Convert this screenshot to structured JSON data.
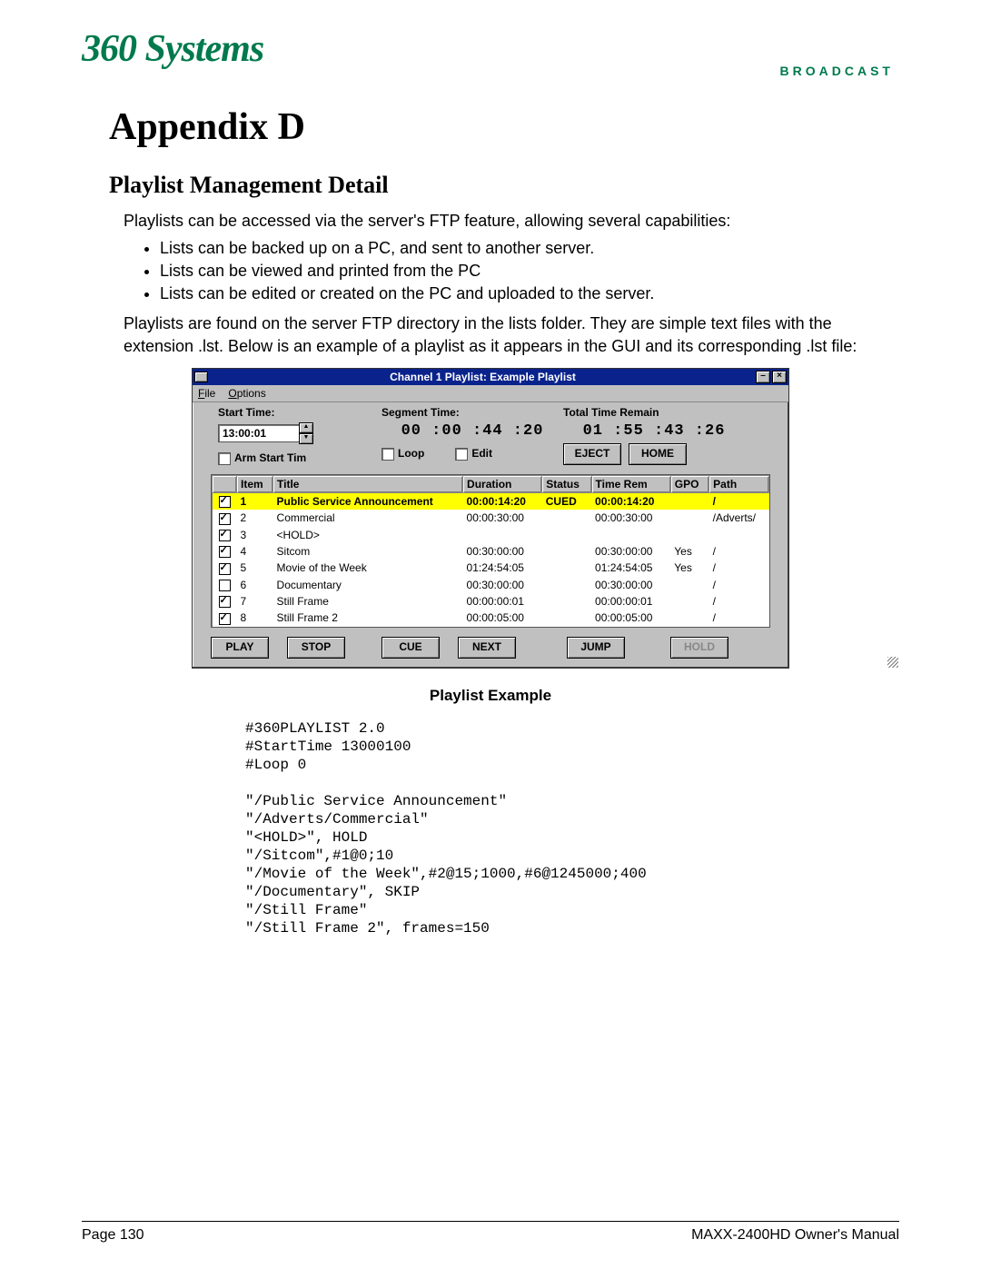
{
  "logo": {
    "script": "360 Systems",
    "broadcast": "BROADCAST"
  },
  "h1": "Appendix D",
  "h2": "Playlist Management Detail",
  "intro": "Playlists can be accessed via the server's FTP feature, allowing several capabilities:",
  "bullets": [
    "Lists can be backed up on a PC, and sent to another server.",
    "Lists can be viewed and printed from the PC",
    "Lists can be edited or created on the PC and uploaded to the server."
  ],
  "para2": "Playlists are found on the server FTP directory in the lists folder.  They are simple text files with the extension .lst.  Below is an example of a playlist as it appears in the GUI and its corresponding .lst file:",
  "window": {
    "title": "Channel  1 Playlist:   Example Playlist",
    "menu": {
      "file": "File",
      "options": "Options"
    },
    "labels": {
      "start": "Start Time:",
      "segment": "Segment Time:",
      "total": "Total Time Remain",
      "arm": "Arm Start Tim",
      "loop": "Loop",
      "edit": "Edit"
    },
    "values": {
      "start": "13:00:01",
      "segment": "00 :00 :44 :20",
      "total": "01 :55 :43 :26"
    },
    "buttons": {
      "eject": "EJECT",
      "home": "HOME",
      "play": "PLAY",
      "stop": "STOP",
      "cue": "CUE",
      "next": "NEXT",
      "jump": "JUMP",
      "hold": "HOLD"
    },
    "columns": [
      "",
      "Item",
      "Title",
      "Duration",
      "Status",
      "Time Rem",
      "GPO",
      "Path"
    ],
    "rows": [
      {
        "checked": true,
        "item": "1",
        "title": "Public Service Announcement",
        "duration": "00:00:14:20",
        "status": "CUED",
        "timerem": "00:00:14:20",
        "gpo": "",
        "path": "/",
        "hl": true
      },
      {
        "checked": true,
        "item": "2",
        "title": "Commercial",
        "duration": "00:00:30:00",
        "status": "",
        "timerem": "00:00:30:00",
        "gpo": "",
        "path": "/Adverts/",
        "hl": false
      },
      {
        "checked": true,
        "item": "3",
        "title": "<HOLD>",
        "duration": "",
        "status": "",
        "timerem": "",
        "gpo": "",
        "path": "",
        "hl": false
      },
      {
        "checked": true,
        "item": "4",
        "title": "Sitcom",
        "duration": "00:30:00:00",
        "status": "",
        "timerem": "00:30:00:00",
        "gpo": "Yes",
        "path": "/",
        "hl": false
      },
      {
        "checked": true,
        "item": "5",
        "title": "Movie of the Week",
        "duration": "01:24:54:05",
        "status": "",
        "timerem": "01:24:54:05",
        "gpo": "Yes",
        "path": "/",
        "hl": false
      },
      {
        "checked": false,
        "item": "6",
        "title": "Documentary",
        "duration": "00:30:00:00",
        "status": "",
        "timerem": "00:30:00:00",
        "gpo": "",
        "path": "/",
        "hl": false
      },
      {
        "checked": true,
        "item": "7",
        "title": "Still Frame",
        "duration": "00:00:00:01",
        "status": "",
        "timerem": "00:00:00:01",
        "gpo": "",
        "path": "/",
        "hl": false
      },
      {
        "checked": true,
        "item": "8",
        "title": "Still Frame 2",
        "duration": "00:00:05:00",
        "status": "",
        "timerem": "00:00:05:00",
        "gpo": "",
        "path": "/",
        "hl": false
      }
    ]
  },
  "caption": "Playlist Example",
  "lst": "#360PLAYLIST 2.0\n#StartTime 13000100\n#Loop 0\n\n\"/Public Service Announcement\"\n\"/Adverts/Commercial\"\n\"<HOLD>\", HOLD\n\"/Sitcom\",#1@0;10\n\"/Movie of the Week\",#2@15;1000,#6@1245000;400\n\"/Documentary\", SKIP\n\"/Still Frame\"\n\"/Still Frame 2\", frames=150",
  "footer": {
    "left": "Page 130",
    "right": "MAXX-2400HD Owner's Manual"
  }
}
